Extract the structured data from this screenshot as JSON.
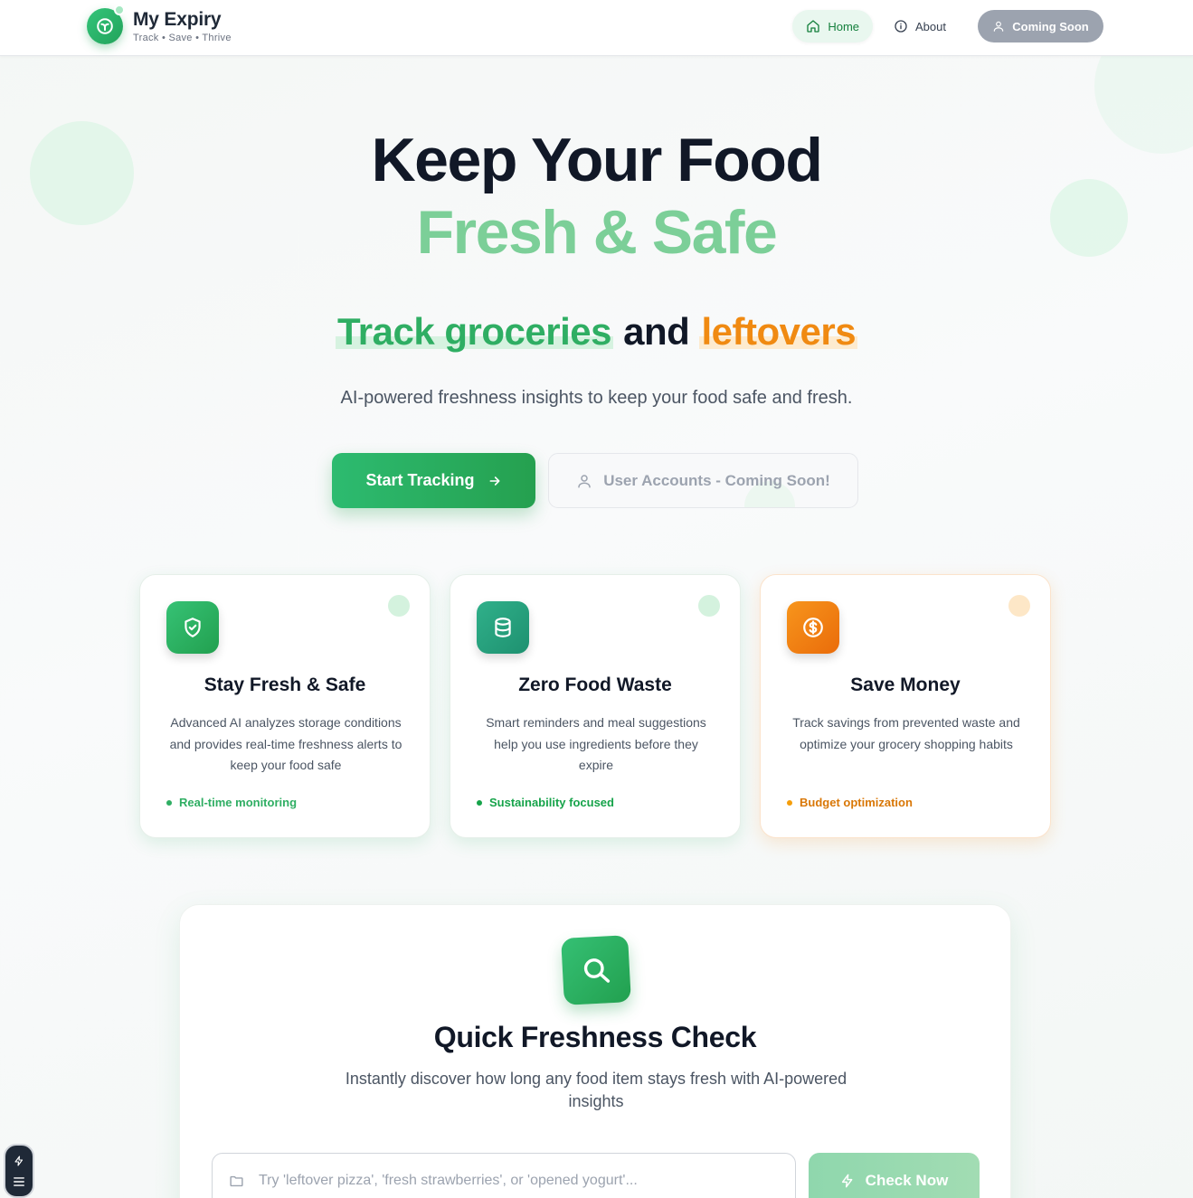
{
  "brand": {
    "name": "My Expiry",
    "tagline": "Track • Save • Thrive"
  },
  "nav": {
    "home": "Home",
    "about": "About",
    "coming_soon": "Coming Soon"
  },
  "hero": {
    "title_line1": "Keep Your Food",
    "title_line2": "Fresh & Safe",
    "sub_green": "Track groceries",
    "sub_mid": " and ",
    "sub_orange": "leftovers",
    "description": "AI-powered freshness insights to keep your food safe and fresh.",
    "start_button": "Start Tracking",
    "accounts_button": "User Accounts - Coming Soon!"
  },
  "features": [
    {
      "icon": "shield-check-icon",
      "title": "Stay Fresh & Safe",
      "description": "Advanced AI analyzes storage conditions and provides real-time freshness alerts to keep your food safe",
      "tag": "Real-time monitoring",
      "color": "#2fae63"
    },
    {
      "icon": "database-icon",
      "title": "Zero Food Waste",
      "description": "Smart reminders and meal suggestions help you use ingredients before they expire",
      "tag": "Sustainability focused",
      "color": "#16a34a"
    },
    {
      "icon": "dollar-icon",
      "title": "Save Money",
      "description": "Track savings from prevented waste and optimize your grocery shopping habits",
      "tag": "Budget optimization",
      "color": "#d97706"
    }
  ],
  "quick_check": {
    "title": "Quick Freshness Check",
    "description": "Instantly discover how long any food item stays fresh with AI-powered insights",
    "input_placeholder": "Try 'leftover pizza', 'fresh strawberries', or 'opened yogurt'...",
    "input_value": "",
    "button": "Check Now"
  },
  "colors": {
    "brand_green": "#2fae63",
    "accent_light_green": "#7ccf98",
    "accent_orange": "#f08a12",
    "disabled_gray": "#9ca3af"
  }
}
